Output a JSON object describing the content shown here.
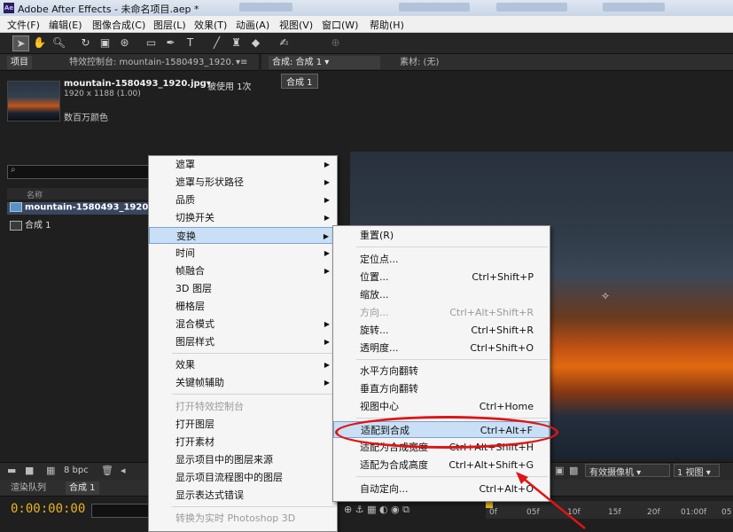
{
  "window": {
    "title": "Adobe After Effects - 未命名项目.aep *"
  },
  "menubar": {
    "items": [
      "文件(F)",
      "编辑(E)",
      "图像合成(C)",
      "图层(L)",
      "效果(T)",
      "动画(A)",
      "视图(V)",
      "窗口(W)",
      "帮助(H)"
    ]
  },
  "project_panel": {
    "tab_project": "项目",
    "tab_effects": "特效控制台: mountain-1580493_1920.",
    "file_name": "mountain-1580493_1920.jpg▾",
    "usage": "被使用 1次",
    "dimensions": "1920 x 1188 (1.00)",
    "colors": "数百万颜色",
    "column_name": "名称",
    "items": [
      {
        "label": "mountain-1580493_1920."
      },
      {
        "label": "合成 1"
      }
    ],
    "bpc": "8 bpc"
  },
  "viewer": {
    "tab_comp": "合成: 合成 1",
    "tab_footage": "素材: (无)",
    "comp_chip": "合成 1",
    "camera": "有效摄像机",
    "views": "1 视图"
  },
  "timeline": {
    "tab_render": "渲染队列",
    "tab_comp": "合成 1",
    "timecode": "0:00:00:00",
    "ticks": [
      "0f",
      "05f",
      "10f",
      "15f",
      "20f",
      "01:00f",
      "05"
    ]
  },
  "context_menu": {
    "items": [
      {
        "label": "遮罩",
        "submenu": true
      },
      {
        "label": "遮罩与形状路径",
        "submenu": true
      },
      {
        "label": "品质",
        "submenu": true
      },
      {
        "label": "切换开关",
        "submenu": true
      },
      {
        "label": "变换",
        "submenu": true,
        "highlighted": true
      },
      {
        "label": "时间",
        "submenu": true
      },
      {
        "label": "帧融合",
        "submenu": true
      },
      {
        "label": "3D 图层"
      },
      {
        "label": "栅格层"
      },
      {
        "label": "混合模式",
        "submenu": true
      },
      {
        "label": "图层样式",
        "submenu": true
      },
      {
        "label": "效果",
        "submenu": true
      },
      {
        "label": "关键帧辅助",
        "submenu": true
      },
      {
        "label": "打开特效控制台",
        "disabled": true
      },
      {
        "label": "打开图层"
      },
      {
        "label": "打开素材"
      },
      {
        "label": "显示项目中的图层来源"
      },
      {
        "label": "显示项目流程图中的图层"
      },
      {
        "label": "显示表达式错误"
      },
      {
        "label": "转换为实时 Photoshop 3D",
        "disabled": true
      }
    ]
  },
  "transform_submenu": {
    "items": [
      {
        "label": "重置(R)",
        "shortcut": ""
      },
      {
        "label": "定位点...",
        "shortcut": ""
      },
      {
        "label": "位置...",
        "shortcut": "Ctrl+Shift+P"
      },
      {
        "label": "缩放...",
        "shortcut": ""
      },
      {
        "label": "方向...",
        "shortcut": "Ctrl+Alt+Shift+R",
        "disabled": true
      },
      {
        "label": "旋转...",
        "shortcut": "Ctrl+Shift+R"
      },
      {
        "label": "透明度...",
        "shortcut": "Ctrl+Shift+O"
      },
      {
        "label": "水平方向翻转",
        "shortcut": ""
      },
      {
        "label": "垂直方向翻转",
        "shortcut": ""
      },
      {
        "label": "视图中心",
        "shortcut": "Ctrl+Home"
      },
      {
        "label": "适配到合成",
        "shortcut": "Ctrl+Alt+F",
        "highlighted": true
      },
      {
        "label": "适配为合成宽度",
        "shortcut": "Ctrl+Alt+Shift+H"
      },
      {
        "label": "适配为合成高度",
        "shortcut": "Ctrl+Alt+Shift+G"
      },
      {
        "label": "自动定向...",
        "shortcut": "Ctrl+Alt+O"
      }
    ]
  },
  "colors": {
    "annotation_red": "#e01414",
    "timecode": "#e8b61f",
    "highlight": "#c9dff5"
  }
}
